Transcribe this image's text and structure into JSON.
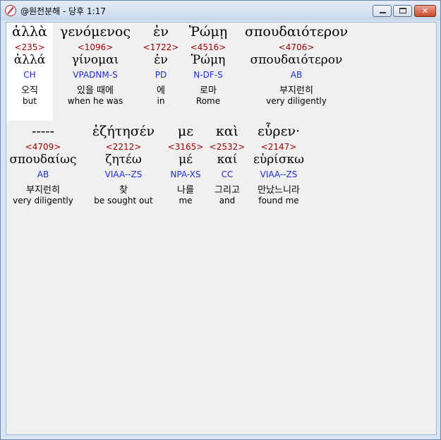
{
  "window": {
    "title": "@원전분해 - 당후 1:17",
    "controls": {
      "minimize": "",
      "maximize": "",
      "close": "✕"
    }
  },
  "rows": [
    {
      "words": [
        {
          "greek": "ἀλλὰ",
          "strong": "<235>",
          "lemma": "ἀλλά",
          "parse": "CH",
          "korean": "오직",
          "english": "but"
        },
        {
          "greek": "γενόμενος",
          "strong": "<1096>",
          "lemma": "γίνομαι",
          "parse": "VPADNM-S",
          "korean": "있을 때에",
          "english": "when he was"
        },
        {
          "greek": "ἐν",
          "strong": "<1722>",
          "lemma": "ἐν",
          "parse": "PD",
          "korean": "에",
          "english": "in"
        },
        {
          "greek": "Ῥώμῃ",
          "strong": "<4516>",
          "lemma": "Ῥώμη",
          "parse": "N-DF-S",
          "korean": "로마",
          "english": "Rome"
        },
        {
          "greek": "σπουδαιότερον",
          "strong": "<4706>",
          "lemma": "σπουδαιότερον",
          "parse": "AB",
          "korean": "부지런히",
          "english": "very diligently"
        }
      ]
    },
    {
      "words": [
        {
          "greek": "-----",
          "strong": "<4709>",
          "lemma": "σπουδαίως",
          "parse": "AB",
          "korean": "부지런히",
          "english": "very diligently"
        },
        {
          "greek": "ἐζήτησέν",
          "strong": "<2212>",
          "lemma": "ζητέω",
          "parse": "VIAA--ZS",
          "korean": "찾",
          "english": "be sought out"
        },
        {
          "greek": "με",
          "strong": "<3165>",
          "lemma": "μέ",
          "parse": "NPA-XS",
          "korean": "나를",
          "english": "me"
        },
        {
          "greek": "καὶ",
          "strong": "<2532>",
          "lemma": "καί",
          "parse": "CC",
          "korean": "그리고",
          "english": "and"
        },
        {
          "greek": "εὗρεν·",
          "strong": "<2147>",
          "lemma": "εὑρίσκω",
          "parse": "VIAA--ZS",
          "korean": "만났느니라",
          "english": "found me"
        }
      ]
    }
  ]
}
